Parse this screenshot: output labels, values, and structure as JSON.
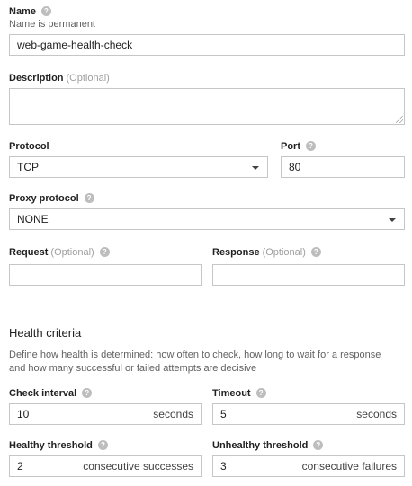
{
  "name": {
    "label": "Name",
    "hint": "Name is permanent",
    "value": "web-game-health-check",
    "help_icon": "help-icon"
  },
  "description": {
    "label": "Description",
    "optional": "(Optional)",
    "value": ""
  },
  "protocol": {
    "label": "Protocol",
    "value": "TCP"
  },
  "port": {
    "label": "Port",
    "value": "80",
    "help_icon": "help-icon"
  },
  "proxy_protocol": {
    "label": "Proxy protocol",
    "value": "NONE",
    "help_icon": "help-icon"
  },
  "request": {
    "label": "Request",
    "optional": "(Optional)",
    "value": ""
  },
  "response": {
    "label": "Response",
    "optional": "(Optional)",
    "value": ""
  },
  "health_criteria": {
    "title": "Health criteria",
    "description": "Define how health is determined: how often to check, how long to wait for a response and how many successful or failed attempts are decisive",
    "check_interval": {
      "label": "Check interval",
      "value": "10",
      "suffix": "seconds"
    },
    "timeout": {
      "label": "Timeout",
      "value": "5",
      "suffix": "seconds"
    },
    "healthy_threshold": {
      "label": "Healthy threshold",
      "value": "2",
      "suffix": "consecutive successes"
    },
    "unhealthy_threshold": {
      "label": "Unhealthy threshold",
      "value": "3",
      "suffix": "consecutive failures"
    }
  },
  "colors": {
    "border": "#c6c6c6",
    "help_icon": "#bdbdbd",
    "optional_text": "#9e9e9e"
  }
}
